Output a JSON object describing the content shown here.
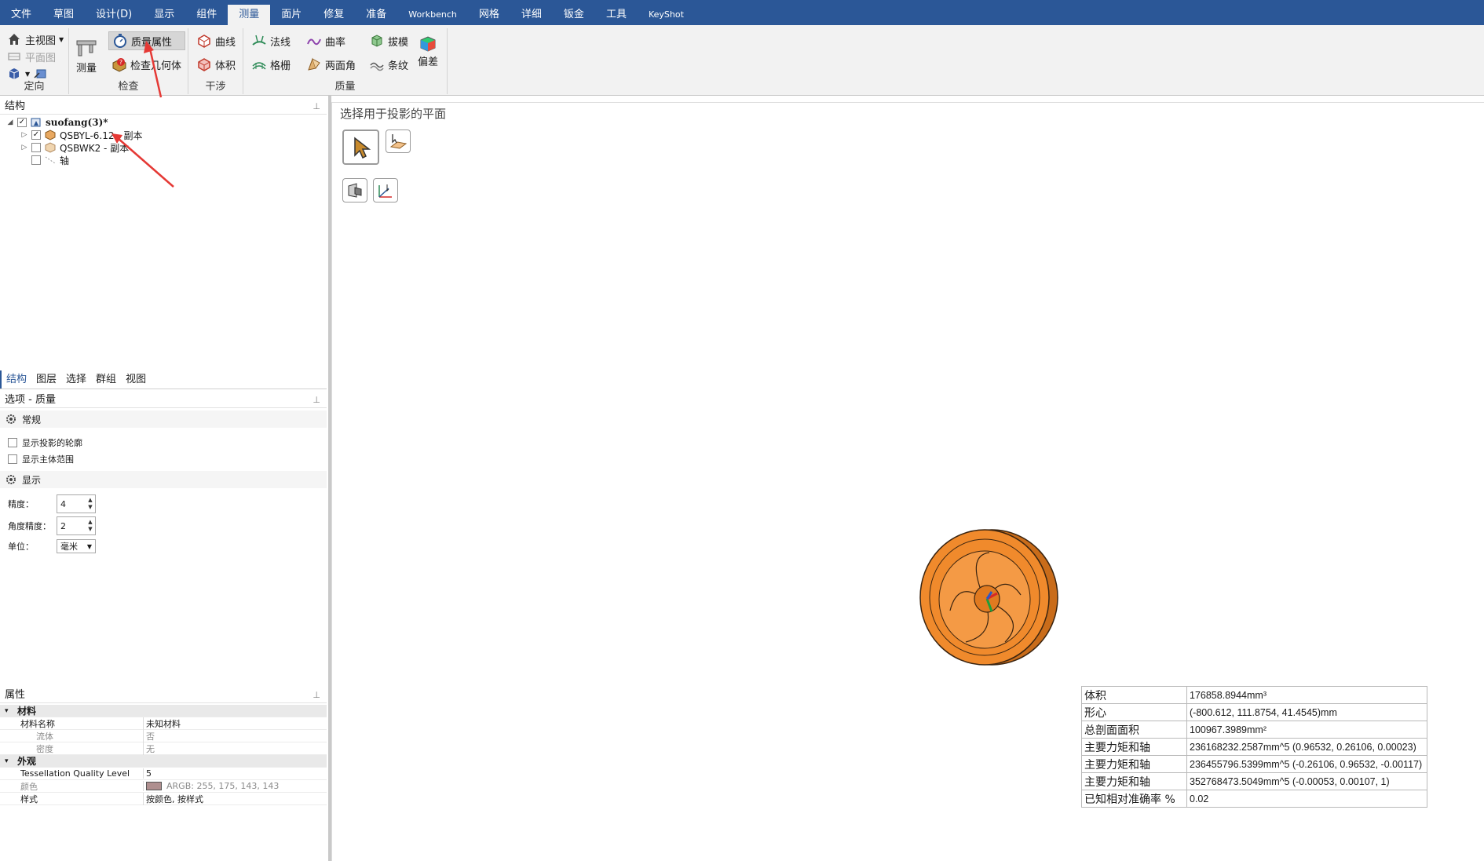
{
  "menu": {
    "items": [
      "文件",
      "草图",
      "设计(D)",
      "显示",
      "组件",
      "测量",
      "面片",
      "修复",
      "准备",
      "Workbench",
      "网格",
      "详细",
      "钣金",
      "工具",
      "KeyShot"
    ],
    "active": "测量"
  },
  "ribbon": {
    "orient": {
      "home": "主视图",
      "plane": "平面图",
      "label": "定向"
    },
    "inspect": {
      "measure": "测量",
      "mass_props": "质量属性",
      "check_geom": "检查几何体",
      "label": "检查"
    },
    "interference": {
      "curve": "曲线",
      "volume": "体积",
      "label": "干涉"
    },
    "quality": {
      "normal": "法线",
      "curvature": "曲率",
      "draft": "拔模",
      "grid": "格栅",
      "dihedral": "两面角",
      "stripes": "条纹",
      "deviation": "偏差",
      "label": "质量"
    }
  },
  "structure": {
    "title": "结构",
    "root": "suofang(3)*",
    "items": [
      {
        "label": "QSBYL-6.12 - 副本",
        "checked": true
      },
      {
        "label": "QSBWK2 - 副本",
        "checked": false
      },
      {
        "label": "轴",
        "checked": false
      }
    ]
  },
  "tabs": [
    "结构",
    "图层",
    "选择",
    "群组",
    "视图"
  ],
  "options": {
    "title": "选项 - 质量",
    "general": "常规",
    "show_proj_outline": "显示投影的轮廓",
    "show_body_range": "显示主体范围",
    "display": "显示",
    "precision_label": "精度：",
    "precision": "4",
    "angle_label": "角度精度：",
    "angle_precision": "2",
    "unit_label": "单位：",
    "unit": "毫米"
  },
  "properties": {
    "title": "属性",
    "material_cat": "材料",
    "material_name_k": "材料名称",
    "material_name_v": "未知材料",
    "fluid_k": "流体",
    "fluid_v": "否",
    "density_k": "密度",
    "density_v": "无",
    "appearance_cat": "外观",
    "tess_k": "Tessellation Quality Level",
    "tess_v": "5",
    "color_k": "颜色",
    "color_v": "ARGB: 255, 175, 143, 143",
    "color_swatch": "#af8f8f",
    "style_k": "样式",
    "style_v": "按颜色, 按样式"
  },
  "viewport": {
    "prompt": "选择用于投影的平面",
    "model_color": "#f08a2c"
  },
  "results": [
    {
      "k": "体积",
      "v": "176858.8944mm³"
    },
    {
      "k": "形心",
      "v": "(-800.612, 111.8754, 41.4545)mm"
    },
    {
      "k": "总剖面面积",
      "v": "100967.3989mm²"
    },
    {
      "k": "主要力矩和轴",
      "v": "236168232.2587mm^5 (0.96532, 0.26106, 0.00023)"
    },
    {
      "k": "主要力矩和轴",
      "v": "236455796.5399mm^5 (-0.26106, 0.96532, -0.00117)"
    },
    {
      "k": "主要力矩和轴",
      "v": "352768473.5049mm^5 (-0.00053, 0.00107, 1)"
    },
    {
      "k": "已知相对准确率 %",
      "v": "0.02"
    }
  ]
}
